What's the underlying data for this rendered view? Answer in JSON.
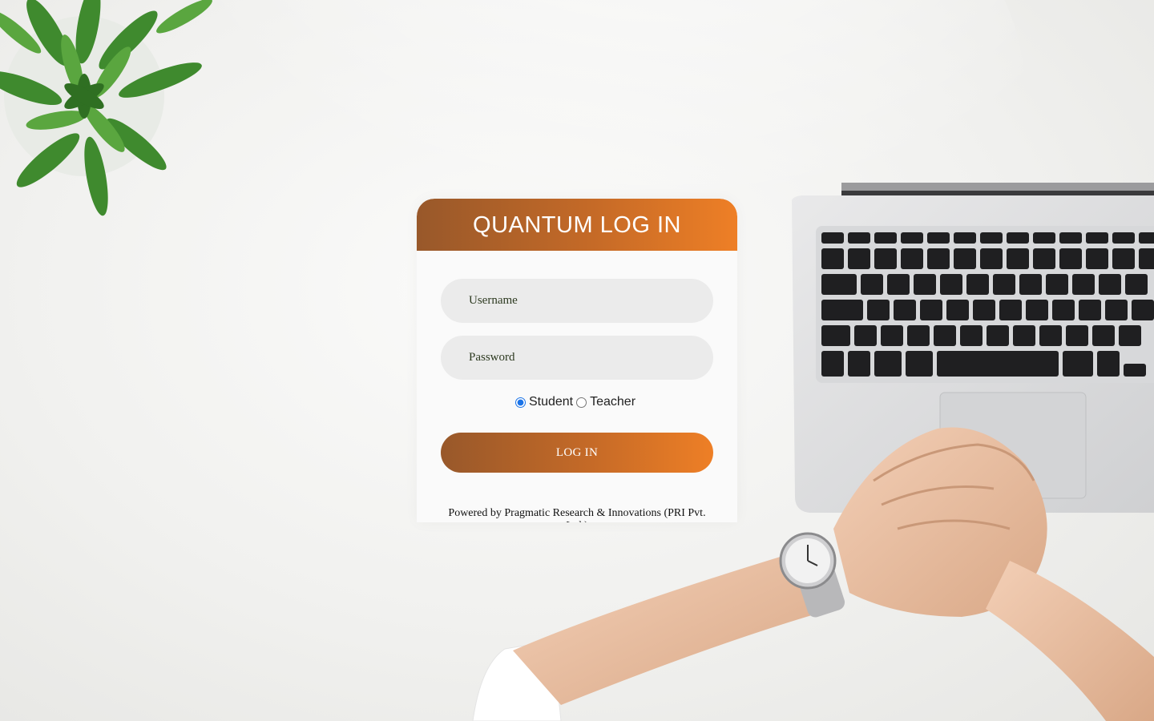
{
  "login": {
    "title": "QUANTUM LOG IN",
    "username_placeholder": "Username",
    "password_placeholder": "Password",
    "roles": [
      {
        "label": "Student",
        "checked": true
      },
      {
        "label": "Teacher",
        "checked": false
      }
    ],
    "submit_label": "LOG IN",
    "footer": "Powered by Pragmatic Research & Innovations (PRI Pvt. Ltd.)"
  },
  "colors": {
    "accent_start": "#98582a",
    "accent_end": "#ee7f26",
    "field_bg": "#ebebeb",
    "radio_selected": "#1a73e8"
  },
  "background": {
    "photo_elements": [
      "succulent-plant",
      "laptop",
      "clasped-hands",
      "wristwatch"
    ]
  }
}
